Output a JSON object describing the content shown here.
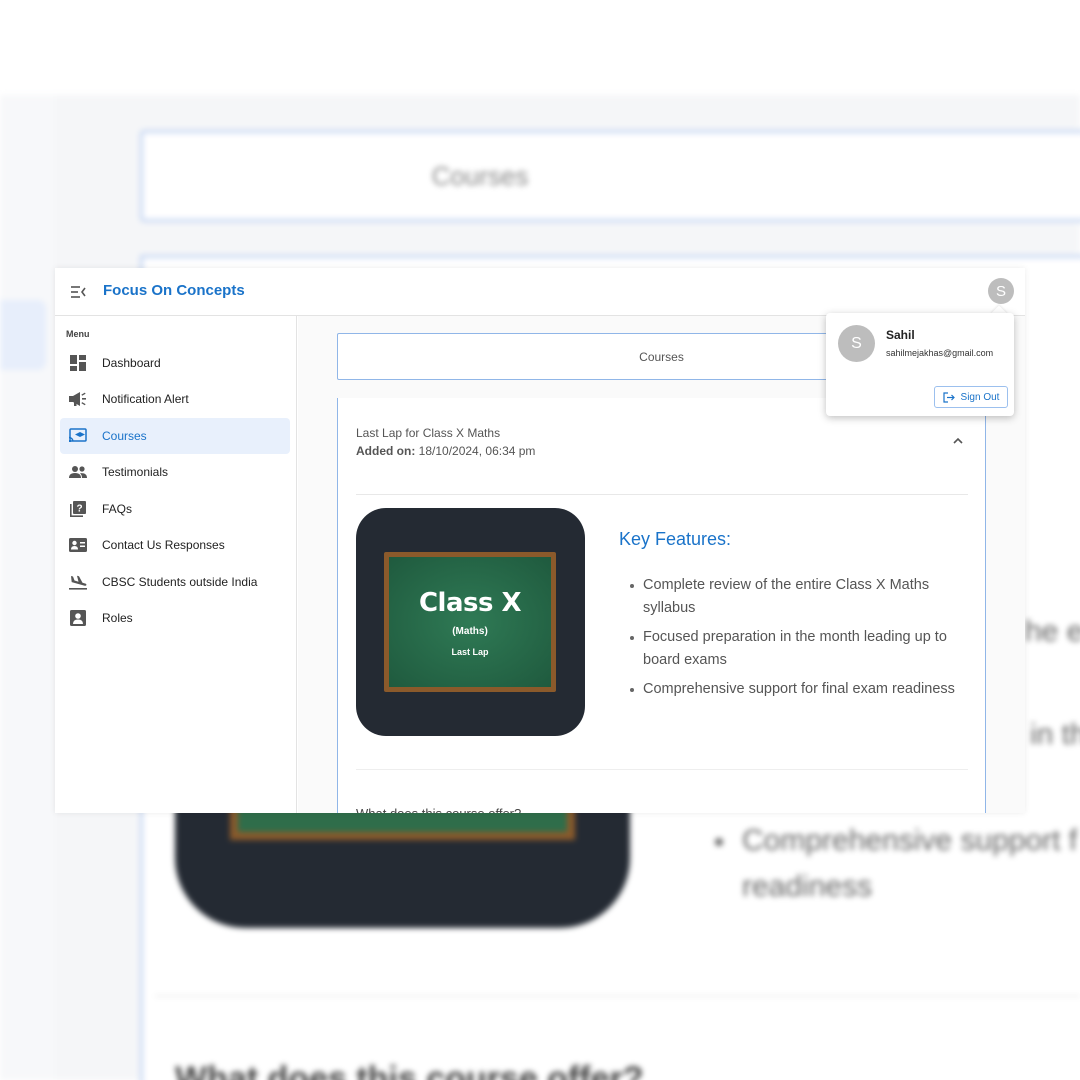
{
  "background": {
    "courses_label": "Courses",
    "text_fragment_1": "he e",
    "text_fragment_2": "in th",
    "bullet_fragment_line1": "Comprehensive support f",
    "bullet_fragment_line2": "readiness"
  },
  "app": {
    "brand": "Focus On Concepts",
    "avatar_initial": "S"
  },
  "sidebar": {
    "heading": "Menu",
    "items": [
      {
        "label": "Dashboard",
        "icon": "dashboard-icon"
      },
      {
        "label": "Notification Alert",
        "icon": "megaphone-icon"
      },
      {
        "label": "Courses",
        "icon": "cast-education-icon",
        "active": true
      },
      {
        "label": "Testimonials",
        "icon": "people-icon"
      },
      {
        "label": "FAQs",
        "icon": "quiz-icon"
      },
      {
        "label": "Contact Us Responses",
        "icon": "contact-card-icon"
      },
      {
        "label": "CBSC Students outside India",
        "icon": "flight-land-icon"
      },
      {
        "label": "Roles",
        "icon": "account-box-icon"
      }
    ]
  },
  "content": {
    "courses_button": "Courses",
    "course": {
      "title": "Last Lap for Class X Maths",
      "added_label": "Added on:",
      "added_value": " 18/10/2024, 06:34 pm",
      "image": {
        "title": "Class X",
        "subtitle": "(Maths)",
        "tagline": "Last Lap"
      },
      "key_features_heading": "Key Features:",
      "key_features": [
        "Complete review of the entire Class X Maths syllabus",
        "Focused preparation in the month leading up to board exams",
        "Comprehensive support for final exam readiness"
      ],
      "next_heading_partial": "What does this course offer?"
    }
  },
  "profile_popup": {
    "avatar_initial": "S",
    "name": "Sahil",
    "email": "sahilmejakhas@gmail.com",
    "sign_out": "Sign Out"
  },
  "colors": {
    "accent": "#1a73c9",
    "active_bg": "#e8f0fc",
    "avatar": "#bdbdbd",
    "course_image_bg": "#242a33"
  }
}
